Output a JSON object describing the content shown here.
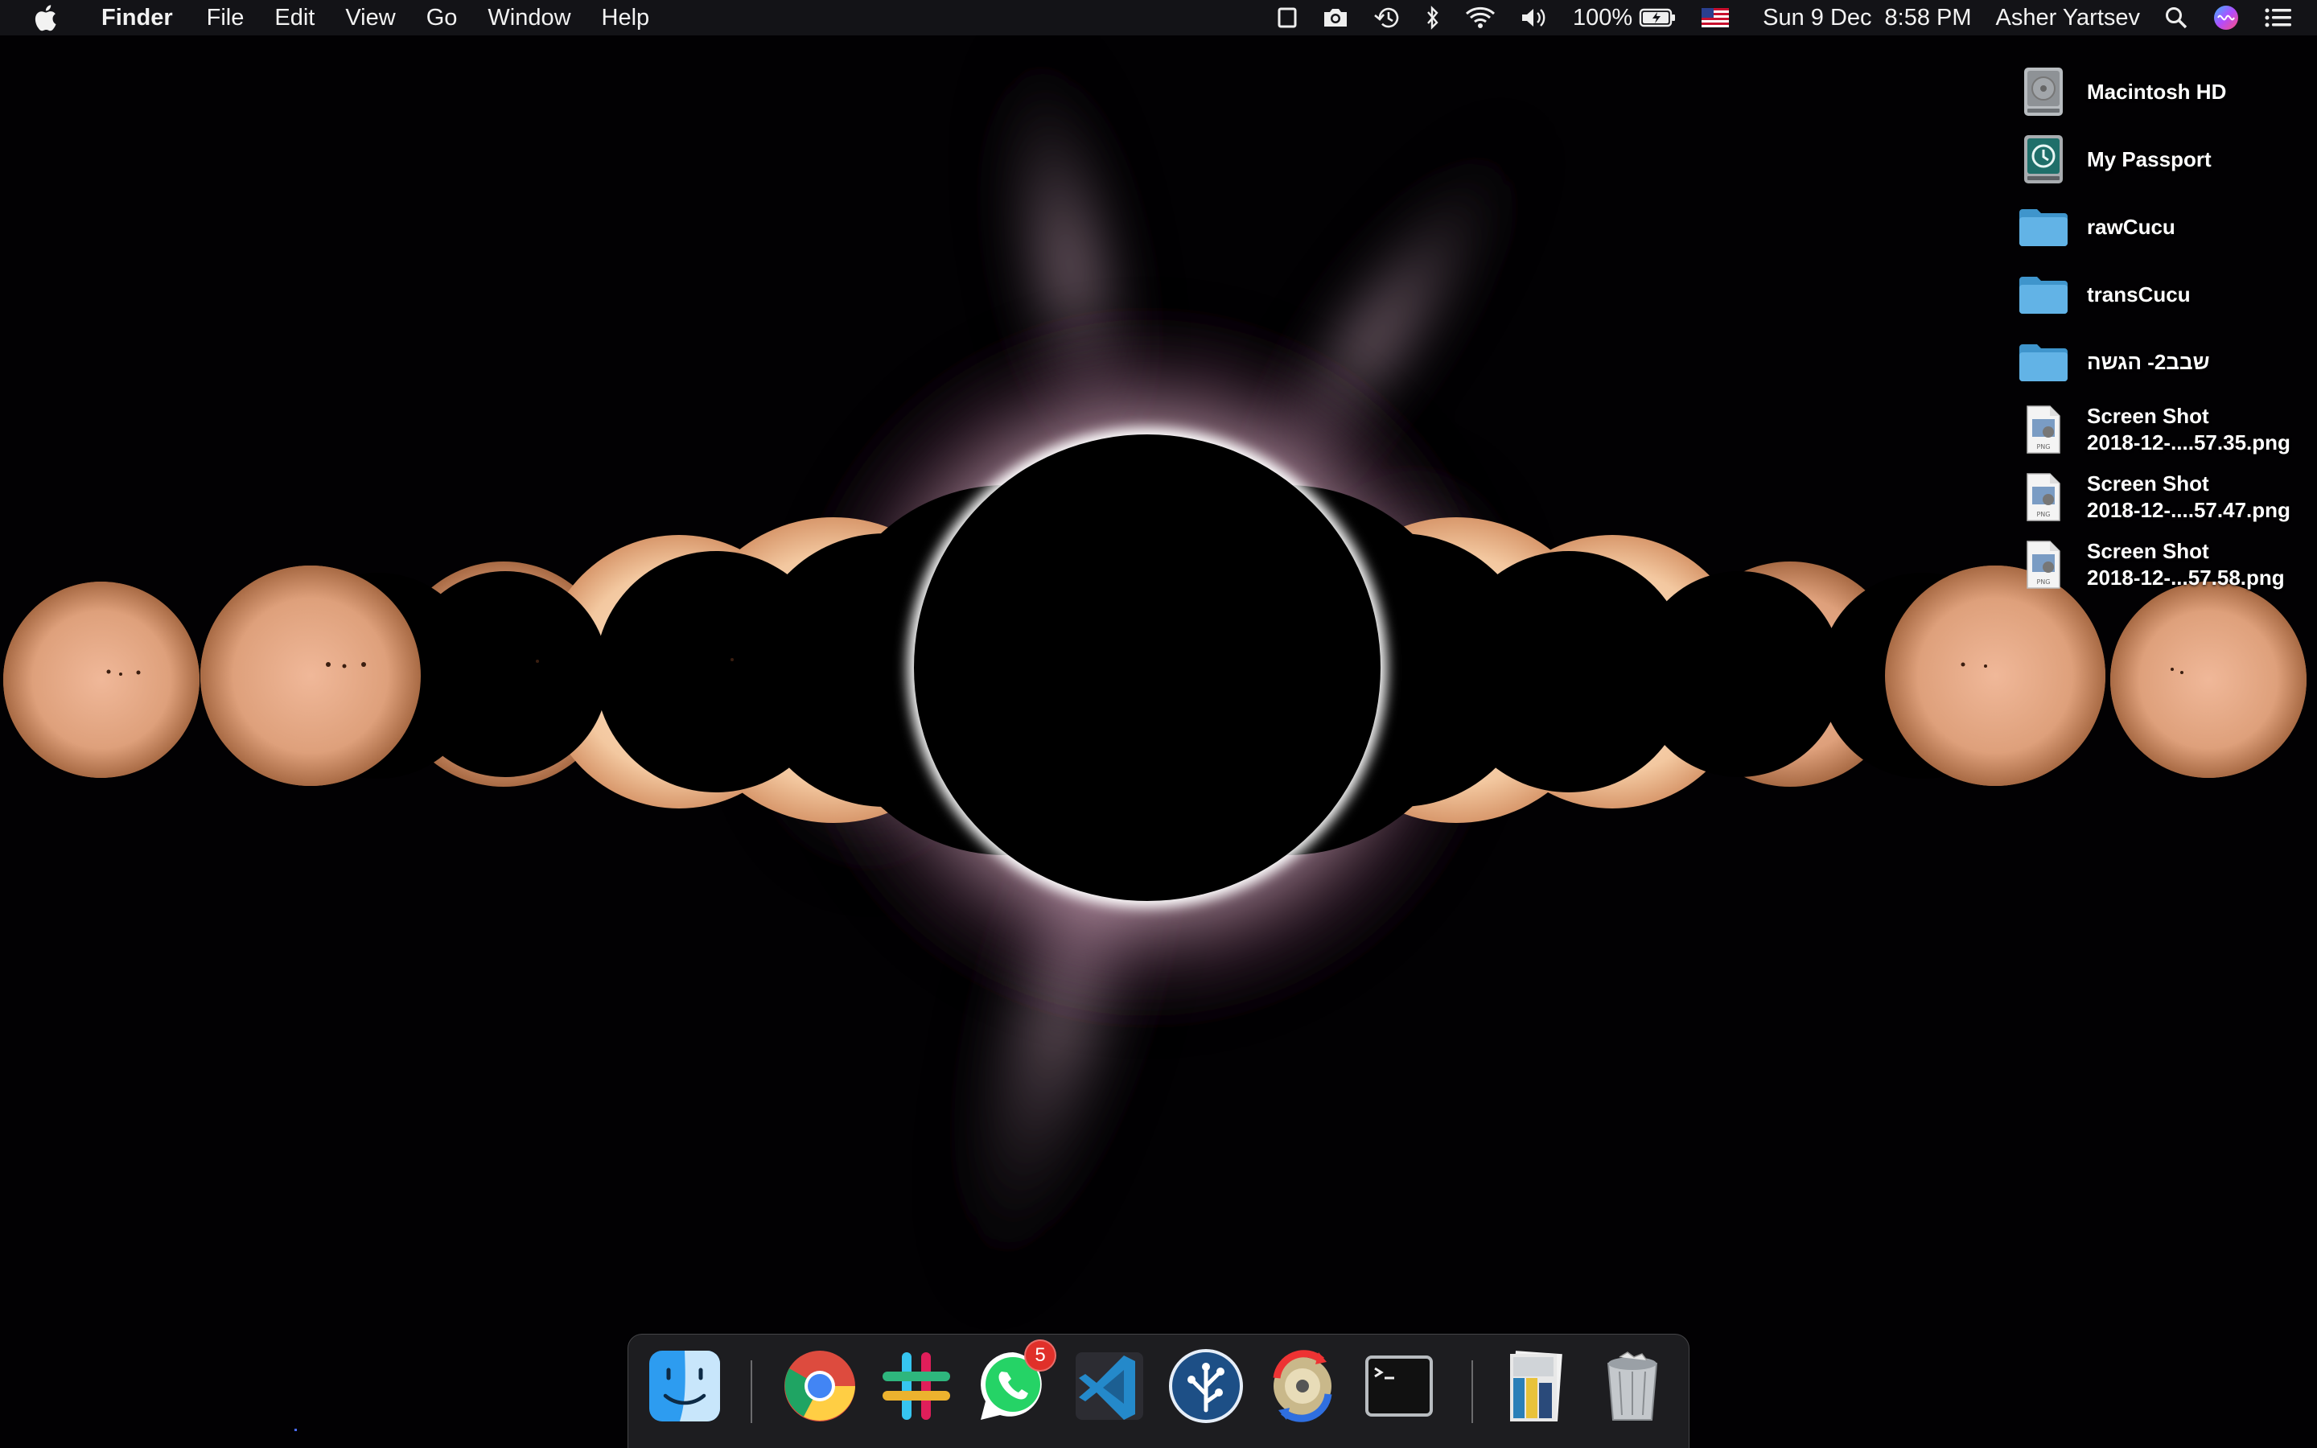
{
  "menubar": {
    "apple_icon": "apple-logo-icon",
    "app_name": "Finder",
    "menus": [
      "File",
      "Edit",
      "View",
      "Go",
      "Window",
      "Help"
    ],
    "battery_percent": "100%",
    "date": "Sun 9 Dec",
    "time": "8:58 PM",
    "user": "Asher Yartsev",
    "status_icons": [
      "screen-mirror-icon",
      "camera-icon",
      "time-machine-icon",
      "bluetooth-icon",
      "wifi-icon",
      "volume-icon",
      "battery-charging-icon",
      "us-flag-icon",
      "spotlight-search-icon",
      "siri-icon",
      "notification-center-icon"
    ]
  },
  "desktop": {
    "items": [
      {
        "label": "Macintosh HD",
        "icon": "hard-drive-icon"
      },
      {
        "label": "My Passport",
        "icon": "time-machine-drive-icon"
      },
      {
        "label": "rawCucu",
        "icon": "folder-icon"
      },
      {
        "label": "transCucu",
        "icon": "folder-icon"
      },
      {
        "label": "שבב2- הגשה",
        "icon": "folder-icon"
      },
      {
        "label_line1": "Screen Shot",
        "label_line2": "2018-12-....57.35.png",
        "icon": "png-file-icon"
      },
      {
        "label_line1": "Screen Shot",
        "label_line2": "2018-12-....57.47.png",
        "icon": "png-file-icon"
      },
      {
        "label_line1": "Screen Shot",
        "label_line2": "2018-12-...57.58.png",
        "icon": "png-file-icon"
      }
    ]
  },
  "dock": {
    "apps": [
      {
        "name": "finder-app-icon",
        "running": true
      },
      {
        "name": "chrome-app-icon",
        "running": true
      },
      {
        "name": "slack-app-icon",
        "running": true
      },
      {
        "name": "whatsapp-app-icon",
        "running": true,
        "badge": "5"
      },
      {
        "name": "vscode-app-icon",
        "running": true
      },
      {
        "name": "sourcetree-app-icon",
        "running": true
      },
      {
        "name": "system-update-app-icon",
        "running": true
      },
      {
        "name": "terminal-app-icon",
        "running": true
      },
      {
        "name": "documents-stack-icon",
        "running": false
      },
      {
        "name": "trash-icon",
        "running": false
      }
    ]
  },
  "colors": {
    "menubar_bg": "#141418",
    "folder_blue": "#5aaee0",
    "badge_red": "#e0302a"
  }
}
